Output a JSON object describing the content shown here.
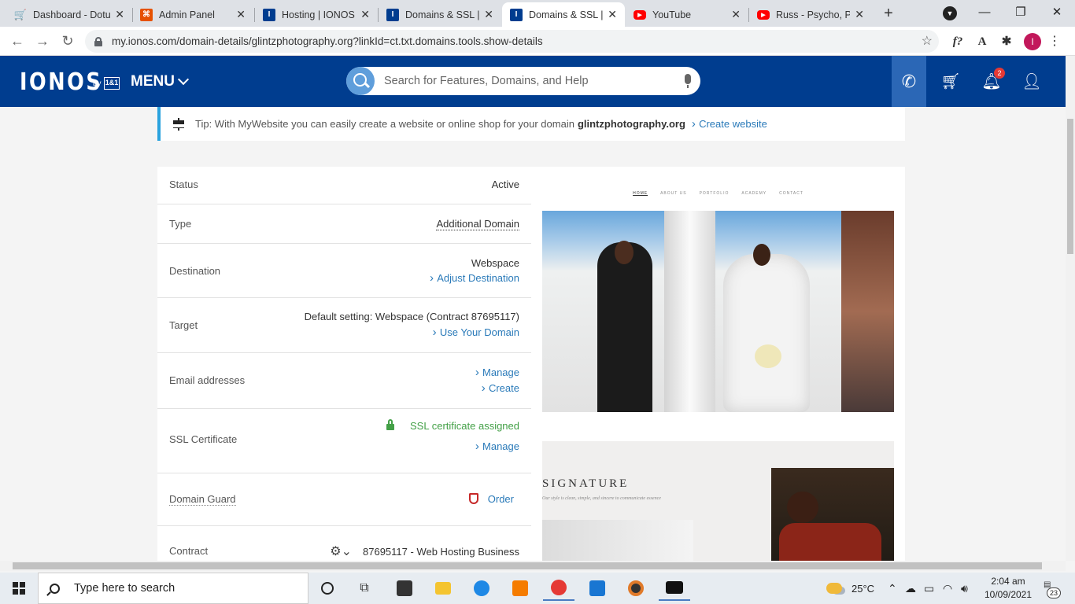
{
  "browser": {
    "tabs": [
      {
        "title": "Dashboard - Dotu",
        "icon": "cart-icon",
        "color": "#d32f2f",
        "active": false
      },
      {
        "title": "Admin Panel",
        "icon": "admin-panel-icon",
        "color": "#e65100",
        "active": false
      },
      {
        "title": "Hosting | IONOS",
        "icon": "ionos-icon",
        "color": "#003d8f",
        "active": false
      },
      {
        "title": "Domains & SSL | I",
        "icon": "ionos-icon",
        "color": "#003d8f",
        "active": false
      },
      {
        "title": "Domains & SSL | I",
        "icon": "ionos-icon",
        "color": "#003d8f",
        "active": true
      },
      {
        "title": "YouTube",
        "icon": "youtube-icon",
        "color": "#ff0000",
        "active": false
      },
      {
        "title": "Russ - Psycho, Pt.",
        "icon": "youtube-icon",
        "color": "#ff0000",
        "active": false
      }
    ],
    "url": "my.ionos.com/domain-details/glintzphotography.org?linkId=ct.txt.domains.tools.show-details",
    "profile_initial": "I"
  },
  "header": {
    "logo": "IONOS",
    "logo_by": "by",
    "logo_brand": "1&1",
    "menu_label": "MENU",
    "search_placeholder": "Search for Features, Domains, and Help",
    "notification_count": "2"
  },
  "tip": {
    "text": "Tip: With MyWebsite you can easily create a website or online shop for your domain",
    "domain": "glintzphotography.org",
    "link": "Create website"
  },
  "details": {
    "status": {
      "label": "Status",
      "value": "Active"
    },
    "type": {
      "label": "Type",
      "value": "Additional Domain"
    },
    "destination": {
      "label": "Destination",
      "value": "Webspace",
      "link": "Adjust Destination"
    },
    "target": {
      "label": "Target",
      "value": "Default setting: Webspace (Contract 87695117)",
      "link": "Use Your Domain"
    },
    "email": {
      "label": "Email addresses",
      "link1": "Manage",
      "link2": "Create"
    },
    "ssl": {
      "label": "SSL Certificate",
      "value": "SSL certificate assigned",
      "link": "Manage",
      "color": "#43a047"
    },
    "guard": {
      "label": "Domain Guard",
      "link": "Order"
    },
    "contract": {
      "label": "Contract",
      "value": "87695117 - Web Hosting Business"
    }
  },
  "preview": {
    "nav": [
      "HOME",
      "ABOUT US",
      "PORTFOLIO",
      "ACADEMY",
      "CONTACT"
    ],
    "section_title": "SIGNATURE",
    "section_sub": "Our style is clean, simple, and sincere to communicate essence"
  },
  "taskbar": {
    "search_text": "Type here to search",
    "temperature": "25°C",
    "time": "2:04 am",
    "date": "10/09/2021",
    "notification_count": "23"
  }
}
